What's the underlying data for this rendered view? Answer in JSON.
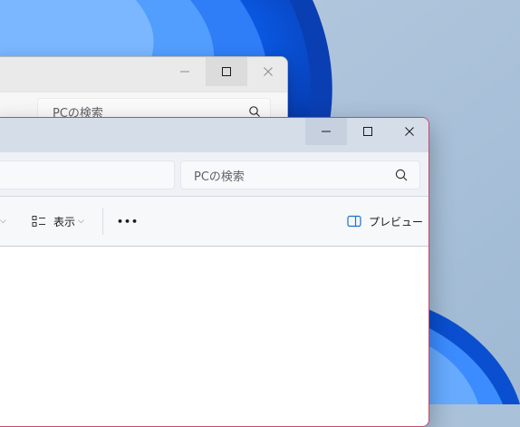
{
  "back_window": {
    "search_placeholder": "PCの検索"
  },
  "front_window": {
    "search_placeholder": "PCの検索",
    "toolbar": {
      "view_label": "表示",
      "more_label": "•••",
      "preview_label": "プレビュー"
    }
  },
  "icons": {
    "caption": [
      "minimize-icon",
      "maximize-icon",
      "close-icon"
    ],
    "search": "search-icon",
    "view": "view-list-icon",
    "preview": "preview-pane-icon"
  },
  "colors": {
    "active_border": "#c04a6a",
    "title_bg": "#d5dde9",
    "wallpaper_blue": "#0a57e0",
    "preview_icon": "#1a73c8"
  }
}
